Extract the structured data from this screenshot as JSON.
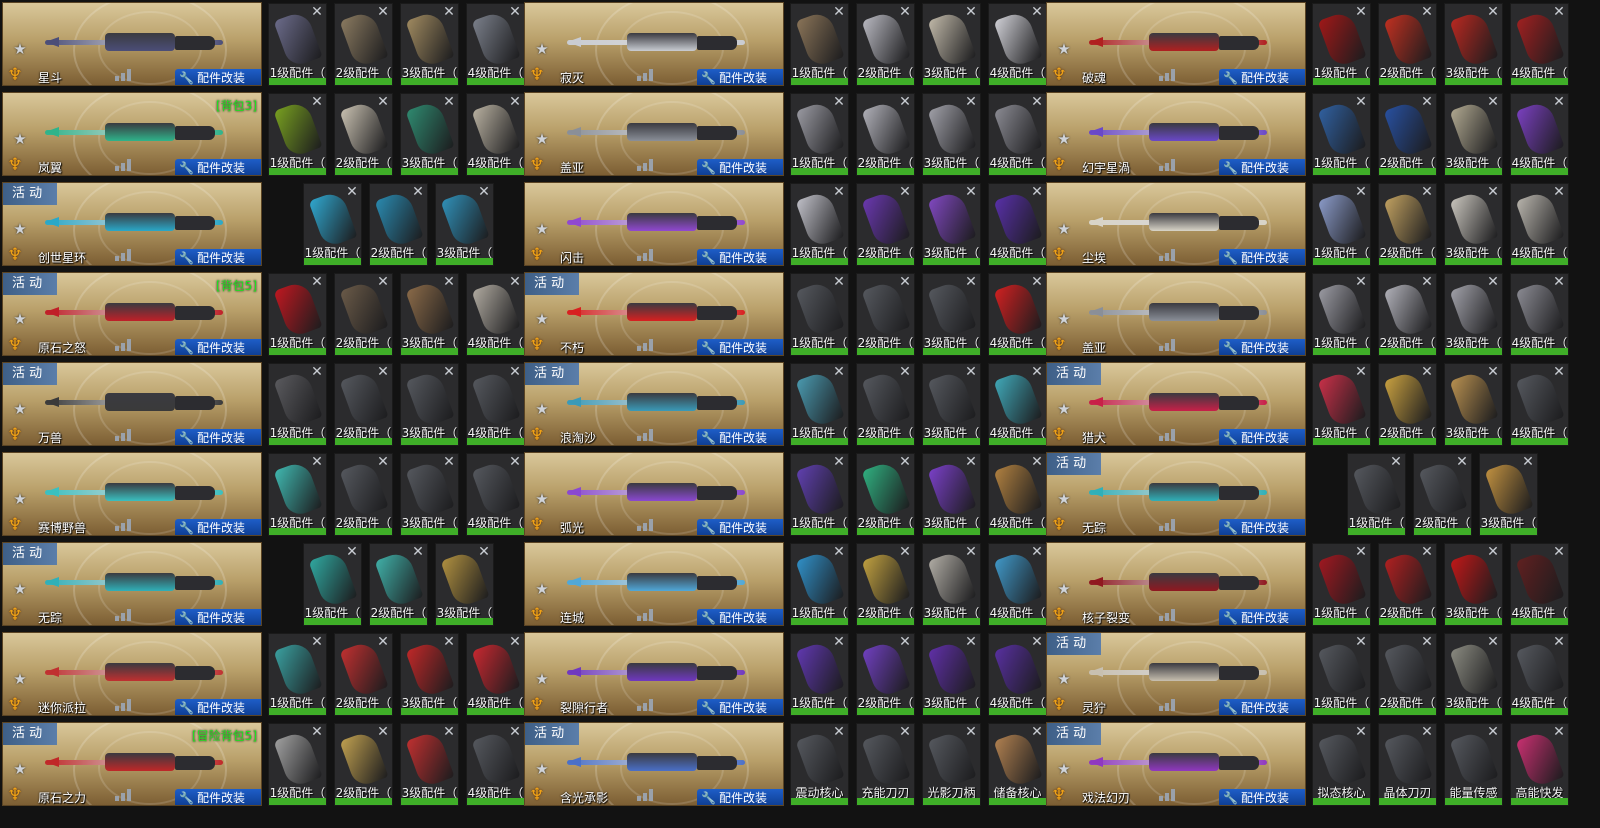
{
  "labels": {
    "mod_button": "配件改装",
    "activity": "活 动"
  },
  "icons": {
    "star": "star-icon",
    "emblem": "wings-emblem-icon",
    "wrench": "wrench-icon",
    "remove": "close-icon"
  },
  "colors": {
    "mod_button": "#1e5ec8",
    "part_bar": "#3fae28",
    "bag_tag": "#20e020",
    "activity_tag": "#4a6c96"
  },
  "rows": [
    [
      {
        "name": "星斗",
        "activity": false,
        "tag": "",
        "accent": "#4b4e78",
        "parts": [
          "1级配件（",
          "2级配件（",
          "3级配件（",
          "4级配件（"
        ],
        "part_tints": [
          "#6b6b8a",
          "#8a7a60",
          "#a08a60",
          "#7a7f8a"
        ]
      },
      {
        "name": "寂灭",
        "activity": false,
        "tag": "",
        "accent": "#c9ccd2",
        "parts": [
          "1级配件（",
          "2级配件（",
          "3级配件（",
          "4级配件（"
        ],
        "part_tints": [
          "#8a7458",
          "#b8b8c0",
          "#c0b8a8",
          "#d0d0d6"
        ]
      },
      {
        "name": "破魂",
        "activity": false,
        "tag": "",
        "accent": "#b02020",
        "parts": [
          "1级配件（",
          "2级配件（",
          "3级配件（",
          "4级配件（"
        ],
        "part_tints": [
          "#a01818",
          "#c03020",
          "#b82820",
          "#a02020"
        ]
      }
    ],
    [
      {
        "name": "岚翼",
        "activity": false,
        "tag": "[背包3]",
        "accent": "#2fb38a",
        "parts": [
          "1级配件（",
          "2级配件（",
          "3级配件（",
          "4级配件（"
        ],
        "part_tints": [
          "#78a020",
          "#c8c0b0",
          "#2f8a70",
          "#b8b0a0"
        ]
      },
      {
        "name": "盖亚",
        "activity": false,
        "tag": "",
        "accent": "#8a8f98",
        "parts": [
          "1级配件（",
          "2级配件（",
          "3级配件（",
          "4级配件（"
        ],
        "part_tints": [
          "#9a9aa2",
          "#b0b0b8",
          "#a0a0a8",
          "#8a8a92"
        ]
      },
      {
        "name": "幻宇星渦",
        "activity": false,
        "tag": "",
        "accent": "#6a48c8",
        "parts": [
          "1级配件（",
          "2级配件（",
          "3级配件（",
          "4级配件（"
        ],
        "part_tints": [
          "#3060a0",
          "#2850a0",
          "#b0a890",
          "#7a40c0"
        ]
      }
    ],
    [
      {
        "name": "创世星环",
        "activity": true,
        "tag": "",
        "accent": "#2aa8c8",
        "parts": [
          "1级配件（",
          "2级配件（",
          "3级配件（"
        ],
        "part_tints": [
          "#30a8d0",
          "#2a8ab0",
          "#3090b8"
        ]
      },
      {
        "name": "闪击",
        "activity": false,
        "tag": "",
        "accent": "#9048d0",
        "parts": [
          "1级配件（",
          "2级配件（",
          "3级配件（",
          "4级配件（"
        ],
        "part_tints": [
          "#c0c0c8",
          "#6a38b0",
          "#8048c0",
          "#5830a8"
        ]
      },
      {
        "name": "尘埃",
        "activity": false,
        "tag": "",
        "accent": "#d8d4c8",
        "parts": [
          "1级配件（",
          "2级配件（",
          "3级配件（",
          "4级配件（"
        ],
        "part_tints": [
          "#8a9ac8",
          "#c0a060",
          "#c8c4bc",
          "#b8b4ac"
        ]
      }
    ],
    [
      {
        "name": "原石之怒",
        "activity": true,
        "tag": "[背包5]",
        "accent": "#c02028",
        "parts": [
          "1级配件（",
          "2级配件（",
          "3级配件（",
          "4级配件（"
        ],
        "part_tints": [
          "#c01820",
          "#6a5a48",
          "#8a6a48",
          "#b0aaa0"
        ]
      },
      {
        "name": "不朽",
        "activity": true,
        "tag": "",
        "accent": "#d82020",
        "parts": [
          "1级配件（",
          "2级配件（",
          "3级配件（",
          "4级配件（"
        ],
        "part_tints": [
          "#55585e",
          "#55585e",
          "#55585e",
          "#d02020"
        ]
      },
      {
        "name": "盖亚",
        "activity": false,
        "tag": "",
        "accent": "#8a8f98",
        "parts": [
          "1级配件（",
          "2级配件（",
          "3级配件（",
          "4级配件（"
        ],
        "part_tints": [
          "#9a9aa2",
          "#b0b0b8",
          "#a0a0a8",
          "#8a8a92"
        ]
      }
    ],
    [
      {
        "name": "万兽",
        "activity": true,
        "tag": "",
        "accent": "#3a3a3a",
        "parts": [
          "1级配件（",
          "2级配件（",
          "3级配件（",
          "4级配件（"
        ],
        "part_tints": [
          "#5a5a5e",
          "#55585e",
          "#55585e",
          "#55585e"
        ]
      },
      {
        "name": "浪淘沙",
        "activity": true,
        "tag": "",
        "accent": "#3a9ab8",
        "parts": [
          "1级配件（",
          "2级配件（",
          "3级配件（",
          "4级配件（"
        ],
        "part_tints": [
          "#4a9ab0",
          "#55585e",
          "#55585e",
          "#40a8b8"
        ]
      },
      {
        "name": "猎犬",
        "activity": true,
        "tag": "",
        "accent": "#c82048",
        "parts": [
          "1级配件（",
          "2级配件（",
          "3级配件（",
          "4级配件（"
        ],
        "part_tints": [
          "#c83048",
          "#c8a040",
          "#b89050",
          "#55585e"
        ]
      }
    ],
    [
      {
        "name": "赛博野兽",
        "activity": false,
        "tag": "",
        "accent": "#3ac0c0",
        "parts": [
          "1级配件（",
          "2级配件（",
          "3级配件（",
          "4级配件（"
        ],
        "part_tints": [
          "#40b8b0",
          "#55585e",
          "#55585e",
          "#55585e"
        ]
      },
      {
        "name": "弧光",
        "activity": false,
        "tag": "",
        "accent": "#8a48d0",
        "parts": [
          "1级配件（",
          "2级配件（",
          "3级配件（",
          "4级配件（"
        ],
        "part_tints": [
          "#6040b0",
          "#30b080",
          "#7a40c8",
          "#b08040"
        ]
      },
      {
        "name": "无踪",
        "activity": true,
        "tag": "",
        "accent": "#30b0b8",
        "parts": [
          "1级配件（",
          "2级配件（",
          "3级配件（"
        ],
        "part_tints": [
          "#55585e",
          "#55585e",
          "#c09040"
        ]
      }
    ],
    [
      {
        "name": "无踪",
        "activity": true,
        "tag": "",
        "accent": "#30b0b8",
        "parts": [
          "1级配件（",
          "2级配件（",
          "3级配件（"
        ],
        "part_tints": [
          "#30a8a0",
          "#40b0a8",
          "#b09040"
        ]
      },
      {
        "name": "连城",
        "activity": false,
        "tag": "",
        "accent": "#50a8d8",
        "parts": [
          "1级配件（",
          "2级配件（",
          "3级配件（",
          "4级配件（"
        ],
        "part_tints": [
          "#3090c8",
          "#c0a040",
          "#b0aca4",
          "#4098c8"
        ]
      },
      {
        "name": "核子裂变",
        "activity": false,
        "tag": "",
        "accent": "#901820",
        "parts": [
          "1级配件（",
          "2级配件（",
          "3级配件（",
          "4级配件（"
        ],
        "part_tints": [
          "#a01820",
          "#b02020",
          "#c01818",
          "#602020"
        ]
      }
    ],
    [
      {
        "name": "迷你派拉",
        "activity": false,
        "tag": "",
        "accent": "#c03030",
        "parts": [
          "1级配件（",
          "2级配件（",
          "3级配件（",
          "4级配件（"
        ],
        "part_tints": [
          "#3aa0a0",
          "#c03030",
          "#c02828",
          "#c82830"
        ]
      },
      {
        "name": "裂隙行者",
        "activity": false,
        "tag": "",
        "accent": "#7038c0",
        "parts": [
          "1级配件（",
          "2级配件（",
          "3级配件（",
          "4级配件（"
        ],
        "part_tints": [
          "#6038b0",
          "#7040c0",
          "#6030a8",
          "#5830a0"
        ]
      },
      {
        "name": "灵狞",
        "activity": true,
        "tag": "",
        "accent": "#c8c0b0",
        "parts": [
          "1级配件（",
          "2级配件（",
          "3级配件（",
          "4级配件（"
        ],
        "part_tints": [
          "#55585e",
          "#55585e",
          "#8a8a80",
          "#55585e"
        ]
      }
    ],
    [
      {
        "name": "原石之力",
        "activity": true,
        "tag": "[冒险背包5]",
        "accent": "#c02828",
        "parts": [
          "1级配件（",
          "2级配件（",
          "3级配件（",
          "4级配件（"
        ],
        "part_tints": [
          "#a0a0a0",
          "#c0a050",
          "#c03030",
          "#55585e"
        ]
      },
      {
        "name": "含光承影",
        "activity": true,
        "tag": "",
        "accent": "#4a70c8",
        "parts": [
          "震动核心",
          "充能刀刃",
          "光影刀柄",
          "储备核心"
        ],
        "part_tints": [
          "#55585e",
          "#55585e",
          "#55585e",
          "#b08050"
        ]
      },
      {
        "name": "戏法幻刃",
        "activity": true,
        "tag": "",
        "accent": "#9038c0",
        "parts": [
          "拟态核心",
          "晶体刀刃",
          "能量传感",
          "高能快发"
        ],
        "part_tints": [
          "#55585e",
          "#55585e",
          "#55585e",
          "#c83070"
        ]
      }
    ]
  ]
}
